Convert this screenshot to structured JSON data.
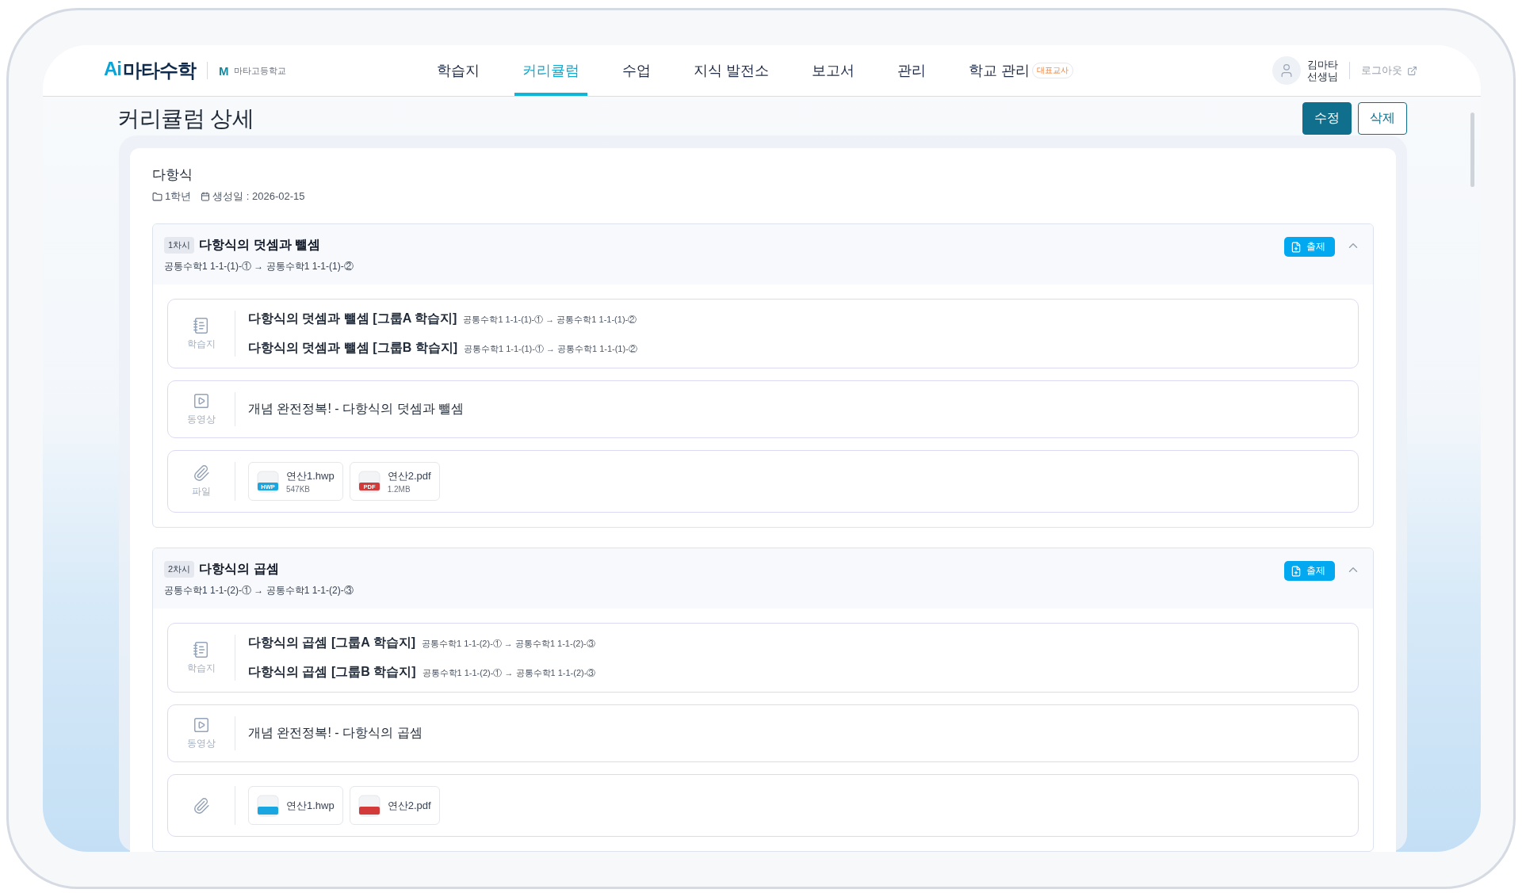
{
  "header": {
    "logo_prefix": "Ai",
    "logo": "마타수학",
    "school_mark": "M",
    "school": "마타고등학교",
    "nav": [
      {
        "label": "학습지",
        "selected": false
      },
      {
        "label": "커리큘럼",
        "selected": true
      },
      {
        "label": "수업",
        "selected": false
      },
      {
        "label": "지식 발전소",
        "selected": false
      },
      {
        "label": "보고서",
        "selected": false
      },
      {
        "label": "관리",
        "selected": false
      },
      {
        "label": "학교 관리",
        "selected": false,
        "badge": "대표교사"
      }
    ],
    "user": {
      "name": "김마타",
      "role": "선생님"
    },
    "logout": "로그아웃"
  },
  "page": {
    "title": "커리큘럼 상세",
    "actions": [
      {
        "label": "수정",
        "kind": "primary"
      },
      {
        "label": "삭제",
        "kind": "outline"
      }
    ]
  },
  "curriculum": {
    "name": "다항식",
    "grade": "1학년",
    "created": "생성일 : 2026-02-15"
  },
  "sessions": [
    {
      "badge": "1차시",
      "title": "다항식의 덧셈과 뺄셈",
      "range": "공통수학1 1-1-(1)-① → 공통수학1 1-1-(1)-②",
      "action": "출제",
      "expanded": true,
      "groups": [
        {
          "kind": "worksheet",
          "label": "학습지",
          "items": [
            {
              "title": "다항식의 덧셈과 뺄셈 [그룹A 학습지]",
              "range": "공통수학1 1-1-(1)-① → 공통수학1 1-1-(1)-②"
            },
            {
              "title": "다항식의 덧셈과 뺄셈 [그룹B 학습지]",
              "range": "공통수학1 1-1-(1)-① → 공통수학1 1-1-(1)-②"
            }
          ]
        },
        {
          "kind": "video",
          "label": "동영상",
          "items": [
            {
              "title": "개념 완전정복! - 다항식의 덧셈과 뺄셈"
            }
          ]
        },
        {
          "kind": "file",
          "label": "파일",
          "files": [
            {
              "kind": "hwp",
              "badge": "HWP",
              "name": "연산1.hwp",
              "size": "547KB"
            },
            {
              "kind": "pdf",
              "badge": "PDF",
              "name": "연산2.pdf",
              "size": "1.2MB"
            }
          ]
        }
      ]
    },
    {
      "badge": "2차시",
      "title": "다항식의 곱셈",
      "range": "공통수학1 1-1-(2)-① → 공통수학1 1-1-(2)-③",
      "action": "출제",
      "expanded": true,
      "groups": [
        {
          "kind": "worksheet",
          "label": "학습지",
          "items": [
            {
              "title": "다항식의 곱셈 [그룹A 학습지]",
              "range": "공통수학1 1-1-(2)-① → 공통수학1 1-1-(2)-③"
            },
            {
              "title": "다항식의 곱셈 [그룹B 학습지]",
              "range": "공통수학1 1-1-(2)-① → 공통수학1 1-1-(2)-③"
            }
          ]
        },
        {
          "kind": "video",
          "label": "동영상",
          "items": [
            {
              "title": "개념 완전정복! - 다항식의 곱셈"
            }
          ]
        },
        {
          "kind": "file",
          "files": [
            {
              "kind": "hwp",
              "name": "연산1.hwp"
            },
            {
              "kind": "pdf",
              "name": "연산2.pdf"
            }
          ]
        }
      ]
    }
  ]
}
